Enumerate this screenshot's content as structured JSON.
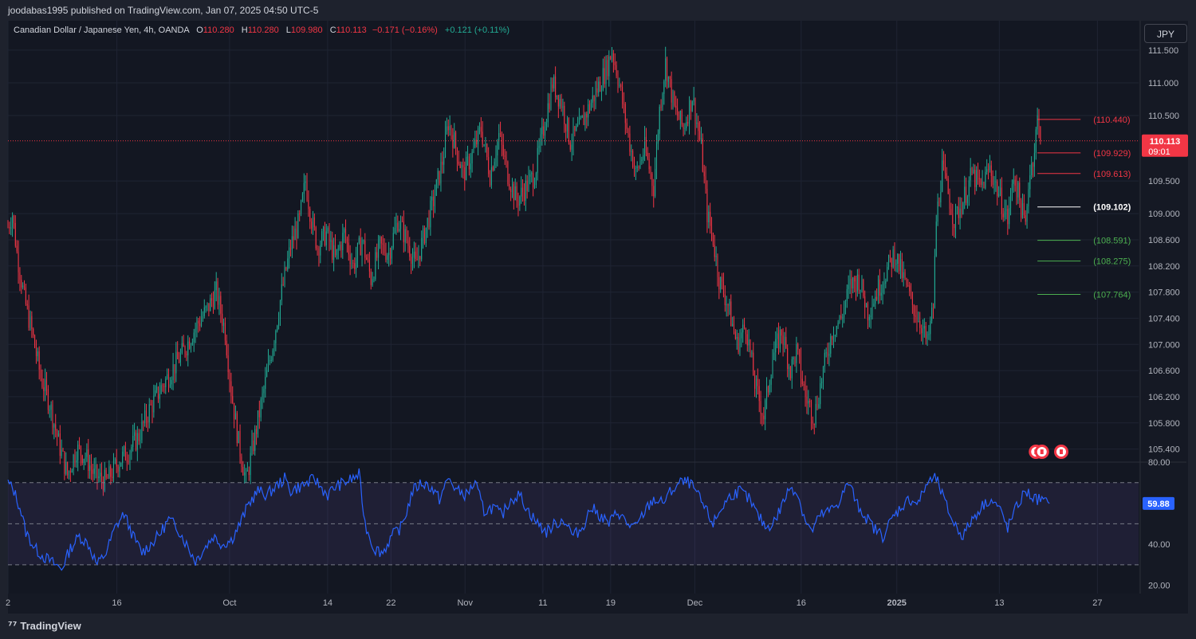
{
  "header": {
    "published_by": "joodabas1995 published on TradingView.com, Jan 07, 2025 04:50 UTC-5"
  },
  "legend": {
    "symbol": "Canadian Dollar / Japanese Yen, 4h, OANDA",
    "o_label": "O",
    "o_value": "110.280",
    "h_label": "H",
    "h_value": "110.280",
    "l_label": "L",
    "l_value": "109.980",
    "c_label": "C",
    "c_value": "110.113",
    "change": "−0.171 (−0.16%)",
    "ext_change": "+0.121 (+0.11%)"
  },
  "currency_button": "JPY",
  "footer": {
    "brand": "TradingView"
  },
  "colors": {
    "up": "#22ab94",
    "down": "#f23645",
    "rsi_line": "#2962ff",
    "rsi_band": "#7e57c2",
    "pivot": "#ffffff"
  },
  "chart_data": [
    {
      "type": "candlestick",
      "symbol": "CADJPY",
      "timeframe": "4h",
      "last_price": "110.113",
      "countdown": "09:01",
      "y_ticks": [
        "111.500",
        "111.000",
        "110.500",
        "109.500",
        "109.000",
        "108.600",
        "108.200",
        "107.800",
        "107.400",
        "107.000",
        "106.600",
        "106.200",
        "105.800",
        "105.400"
      ],
      "ylim": [
        105.2,
        111.95
      ],
      "x_ticks": [
        "2",
        "16",
        "Oct",
        "14",
        "22",
        "Nov",
        "11",
        "19",
        "Dec",
        "16",
        "2025",
        "13",
        "27"
      ],
      "price_path_anchors": [
        [
          0,
          108.8
        ],
        [
          3,
          109.0
        ],
        [
          6,
          108.4
        ],
        [
          11,
          107.7
        ],
        [
          16,
          107.2
        ],
        [
          22,
          106.5
        ],
        [
          28,
          106.1
        ],
        [
          34,
          105.5
        ],
        [
          40,
          105.0
        ],
        [
          46,
          105.4
        ],
        [
          52,
          105.3
        ],
        [
          58,
          105.0
        ],
        [
          66,
          104.9
        ],
        [
          74,
          105.2
        ],
        [
          82,
          105.4
        ],
        [
          88,
          105.6
        ],
        [
          95,
          106.0
        ],
        [
          102,
          106.3
        ],
        [
          110,
          106.6
        ],
        [
          118,
          106.9
        ],
        [
          127,
          107.3
        ],
        [
          133,
          107.5
        ],
        [
          140,
          107.8
        ],
        [
          146,
          107.2
        ],
        [
          150,
          106.3
        ],
        [
          155,
          105.5
        ],
        [
          160,
          104.9
        ],
        [
          166,
          105.6
        ],
        [
          172,
          106.3
        ],
        [
          178,
          107.0
        ],
        [
          184,
          107.8
        ],
        [
          190,
          108.5
        ],
        [
          196,
          108.9
        ],
        [
          200,
          109.5
        ],
        [
          204,
          108.9
        ],
        [
          208,
          108.5
        ],
        [
          214,
          108.7
        ],
        [
          220,
          108.3
        ],
        [
          226,
          108.7
        ],
        [
          232,
          108.2
        ],
        [
          238,
          108.6
        ],
        [
          244,
          108.0
        ],
        [
          250,
          108.5
        ],
        [
          256,
          108.4
        ],
        [
          262,
          108.9
        ],
        [
          268,
          108.6
        ],
        [
          274,
          108.2
        ],
        [
          280,
          108.7
        ],
        [
          286,
          109.2
        ],
        [
          292,
          109.8
        ],
        [
          296,
          110.4
        ],
        [
          300,
          110.1
        ],
        [
          306,
          109.6
        ],
        [
          312,
          109.9
        ],
        [
          318,
          110.3
        ],
        [
          324,
          109.6
        ],
        [
          330,
          110.2
        ],
        [
          336,
          109.6
        ],
        [
          342,
          109.2
        ],
        [
          348,
          109.4
        ],
        [
          354,
          109.6
        ],
        [
          360,
          110.3
        ],
        [
          366,
          111.0
        ],
        [
          372,
          110.7
        ],
        [
          378,
          110.1
        ],
        [
          384,
          110.3
        ],
        [
          390,
          110.6
        ],
        [
          396,
          110.9
        ],
        [
          402,
          111.2
        ],
        [
          406,
          111.5
        ],
        [
          410,
          111.1
        ],
        [
          416,
          110.3
        ],
        [
          422,
          109.6
        ],
        [
          428,
          110.0
        ],
        [
          434,
          109.4
        ],
        [
          438,
          110.6
        ],
        [
          442,
          111.3
        ],
        [
          448,
          110.6
        ],
        [
          454,
          110.3
        ],
        [
          460,
          110.8
        ],
        [
          466,
          110.0
        ],
        [
          470,
          109.0
        ],
        [
          474,
          108.6
        ],
        [
          478,
          108.0
        ],
        [
          484,
          107.6
        ],
        [
          490,
          107.0
        ],
        [
          496,
          107.3
        ],
        [
          502,
          106.4
        ],
        [
          508,
          105.9
        ],
        [
          514,
          106.8
        ],
        [
          520,
          107.2
        ],
        [
          526,
          106.6
        ],
        [
          530,
          106.9
        ],
        [
          536,
          106.2
        ],
        [
          542,
          105.9
        ],
        [
          548,
          106.6
        ],
        [
          554,
          107.2
        ],
        [
          560,
          107.4
        ],
        [
          566,
          107.9
        ],
        [
          572,
          108.0
        ],
        [
          578,
          107.5
        ],
        [
          584,
          107.8
        ],
        [
          590,
          108.1
        ],
        [
          596,
          108.4
        ],
        [
          602,
          108.0
        ],
        [
          608,
          107.6
        ],
        [
          614,
          107.3
        ],
        [
          618,
          107.0
        ],
        [
          622,
          107.6
        ],
        [
          624,
          108.9
        ],
        [
          628,
          109.7
        ],
        [
          632,
          109.3
        ],
        [
          636,
          108.9
        ],
        [
          642,
          109.2
        ],
        [
          648,
          109.6
        ],
        [
          654,
          109.4
        ],
        [
          660,
          109.7
        ],
        [
          666,
          109.3
        ],
        [
          672,
          108.9
        ],
        [
          676,
          109.6
        ],
        [
          680,
          109.2
        ],
        [
          684,
          108.8
        ],
        [
          686,
          109.5
        ],
        [
          690,
          110.0
        ],
        [
          692,
          110.44
        ],
        [
          694,
          110.1
        ]
      ],
      "levels": [
        {
          "value": 110.44,
          "label": "(110.440)",
          "color": "#f23645"
        },
        {
          "value": 109.929,
          "label": "(109.929)",
          "color": "#f23645"
        },
        {
          "value": 109.613,
          "label": "(109.613)",
          "color": "#f23645"
        },
        {
          "value": 109.102,
          "label": "(109.102)",
          "color": "#ffffff"
        },
        {
          "value": 108.591,
          "label": "(108.591)",
          "color": "#4caf50"
        },
        {
          "value": 108.275,
          "label": "(108.275)",
          "color": "#4caf50"
        },
        {
          "value": 107.764,
          "label": "(107.764)",
          "color": "#4caf50"
        }
      ]
    },
    {
      "type": "line",
      "name": "RSI",
      "last_value": "59.88",
      "y_ticks": [
        "80.00",
        "40.00",
        "20.00"
      ],
      "ylim": [
        16,
        80
      ],
      "bands": [
        70,
        50,
        30
      ],
      "rsi_path_anchors": [
        [
          0,
          70
        ],
        [
          4,
          66
        ],
        [
          8,
          58
        ],
        [
          12,
          46
        ],
        [
          18,
          38
        ],
        [
          24,
          34
        ],
        [
          30,
          31
        ],
        [
          36,
          28
        ],
        [
          42,
          38
        ],
        [
          48,
          44
        ],
        [
          54,
          40
        ],
        [
          60,
          30
        ],
        [
          66,
          36
        ],
        [
          72,
          48
        ],
        [
          78,
          55
        ],
        [
          84,
          44
        ],
        [
          90,
          36
        ],
        [
          96,
          40
        ],
        [
          102,
          45
        ],
        [
          108,
          52
        ],
        [
          114,
          48
        ],
        [
          120,
          40
        ],
        [
          126,
          32
        ],
        [
          132,
          38
        ],
        [
          138,
          44
        ],
        [
          144,
          40
        ],
        [
          150,
          42
        ],
        [
          156,
          50
        ],
        [
          162,
          60
        ],
        [
          168,
          66
        ],
        [
          174,
          64
        ],
        [
          180,
          68
        ],
        [
          186,
          72
        ],
        [
          190,
          66
        ],
        [
          196,
          68
        ],
        [
          202,
          70
        ],
        [
          206,
          72
        ],
        [
          210,
          68
        ],
        [
          215,
          64
        ],
        [
          220,
          68
        ],
        [
          226,
          70
        ],
        [
          232,
          72
        ],
        [
          236,
          74
        ],
        [
          240,
          50
        ],
        [
          246,
          38
        ],
        [
          252,
          36
        ],
        [
          258,
          44
        ],
        [
          264,
          48
        ],
        [
          268,
          56
        ],
        [
          272,
          66
        ],
        [
          278,
          70
        ],
        [
          284,
          68
        ],
        [
          290,
          62
        ],
        [
          296,
          72
        ],
        [
          302,
          66
        ],
        [
          308,
          64
        ],
        [
          314,
          70
        ],
        [
          320,
          56
        ],
        [
          326,
          58
        ],
        [
          332,
          54
        ],
        [
          338,
          62
        ],
        [
          344,
          64
        ],
        [
          350,
          56
        ],
        [
          356,
          50
        ],
        [
          362,
          46
        ],
        [
          368,
          50
        ],
        [
          374,
          52
        ],
        [
          380,
          44
        ],
        [
          386,
          48
        ],
        [
          392,
          58
        ],
        [
          398,
          54
        ],
        [
          404,
          50
        ],
        [
          410,
          56
        ],
        [
          416,
          50
        ],
        [
          422,
          48
        ],
        [
          428,
          56
        ],
        [
          434,
          62
        ],
        [
          440,
          60
        ],
        [
          446,
          66
        ],
        [
          452,
          70
        ],
        [
          458,
          70
        ],
        [
          462,
          66
        ],
        [
          468,
          58
        ],
        [
          474,
          50
        ],
        [
          480,
          58
        ],
        [
          486,
          64
        ],
        [
          492,
          66
        ],
        [
          498,
          62
        ],
        [
          504,
          54
        ],
        [
          510,
          48
        ],
        [
          516,
          52
        ],
        [
          522,
          62
        ],
        [
          526,
          68
        ],
        [
          530,
          66
        ],
        [
          536,
          52
        ],
        [
          540,
          46
        ],
        [
          546,
          54
        ],
        [
          552,
          56
        ],
        [
          558,
          60
        ],
        [
          562,
          66
        ],
        [
          566,
          70
        ],
        [
          570,
          60
        ],
        [
          576,
          54
        ],
        [
          582,
          48
        ],
        [
          588,
          44
        ],
        [
          594,
          52
        ],
        [
          600,
          58
        ],
        [
          606,
          62
        ],
        [
          612,
          60
        ],
        [
          618,
          70
        ],
        [
          624,
          72
        ],
        [
          630,
          60
        ],
        [
          636,
          50
        ],
        [
          642,
          44
        ],
        [
          648,
          52
        ],
        [
          654,
          58
        ],
        [
          660,
          62
        ],
        [
          666,
          58
        ],
        [
          672,
          48
        ],
        [
          678,
          58
        ],
        [
          684,
          66
        ],
        [
          690,
          62
        ],
        [
          694,
          62
        ],
        [
          698,
          60
        ],
        [
          700,
          59.88
        ]
      ]
    }
  ]
}
